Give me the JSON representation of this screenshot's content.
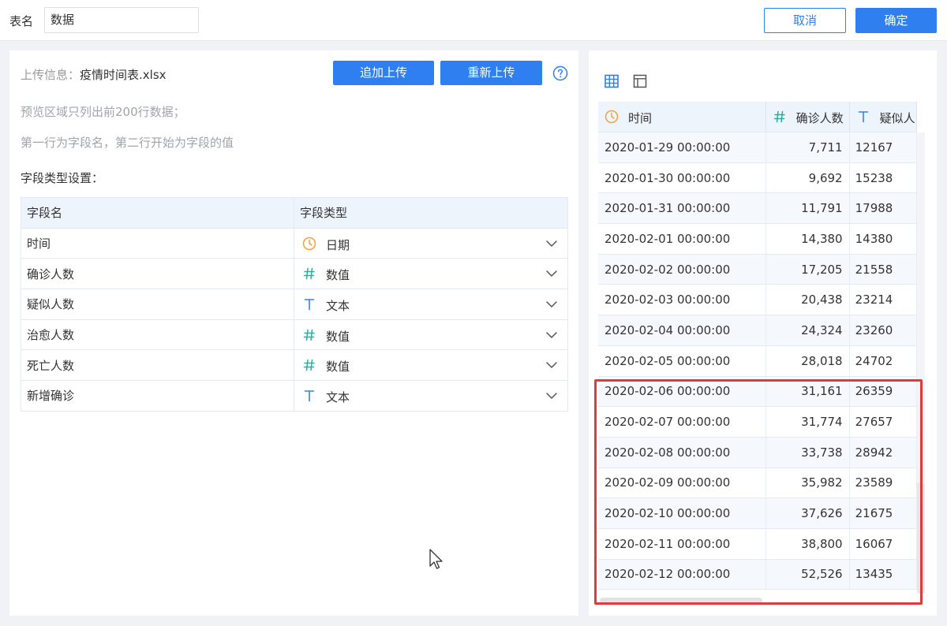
{
  "header": {
    "table_name_label": "表名",
    "table_name_value": "数据",
    "cancel_label": "取消",
    "confirm_label": "确定"
  },
  "upload": {
    "info_key": "上传信息：",
    "file_name": "疫情时间表.xlsx",
    "append_label": "追加上传",
    "reupload_label": "重新上传",
    "hint_preview": "预览区域只列出前200行数据；",
    "hint_rows": "第一行为字段名，第二行开始为字段的值",
    "section_title": "字段类型设置："
  },
  "field_table": {
    "headers": [
      "字段名",
      "字段类型"
    ],
    "rows": [
      {
        "name": "时间",
        "type": "日期",
        "icon": "clock-icon"
      },
      {
        "name": "确诊人数",
        "type": "数值",
        "icon": "hash-icon"
      },
      {
        "name": "疑似人数",
        "type": "文本",
        "icon": "text-t-icon"
      },
      {
        "name": "治愈人数",
        "type": "数值",
        "icon": "hash-icon"
      },
      {
        "name": "死亡人数",
        "type": "数值",
        "icon": "hash-icon"
      },
      {
        "name": "新增确诊",
        "type": "文本",
        "icon": "text-t-icon"
      }
    ]
  },
  "preview": {
    "columns": [
      {
        "label": "时间",
        "icon": "clock-icon"
      },
      {
        "label": "确诊人数",
        "icon": "hash-icon"
      },
      {
        "label": "疑似人",
        "icon": "text-t-icon"
      }
    ],
    "rows": [
      [
        "2020-01-29 00:00:00",
        "7,711",
        "12167"
      ],
      [
        "2020-01-30 00:00:00",
        "9,692",
        "15238"
      ],
      [
        "2020-01-31 00:00:00",
        "11,791",
        "17988"
      ],
      [
        "2020-02-01 00:00:00",
        "14,380",
        "14380"
      ],
      [
        "2020-02-02 00:00:00",
        "17,205",
        "21558"
      ],
      [
        "2020-02-03 00:00:00",
        "20,438",
        "23214"
      ],
      [
        "2020-02-04 00:00:00",
        "24,324",
        "23260"
      ],
      [
        "2020-02-05 00:00:00",
        "28,018",
        "24702"
      ],
      [
        "2020-02-06 00:00:00",
        "31,161",
        "26359"
      ],
      [
        "2020-02-07 00:00:00",
        "31,774",
        "27657"
      ],
      [
        "2020-02-08 00:00:00",
        "33,738",
        "28942"
      ],
      [
        "2020-02-09 00:00:00",
        "35,982",
        "23589"
      ],
      [
        "2020-02-10 00:00:00",
        "37,626",
        "21675"
      ],
      [
        "2020-02-11 00:00:00",
        "38,800",
        "16067"
      ],
      [
        "2020-02-12 00:00:00",
        "52,526",
        "13435"
      ]
    ]
  },
  "colors": {
    "primary": "#2f7ff0",
    "clock_icon": "#f5a23a",
    "hash_icon": "#27b39a",
    "text_icon": "#3b7ff0",
    "highlight_border": "#e03a3a"
  }
}
